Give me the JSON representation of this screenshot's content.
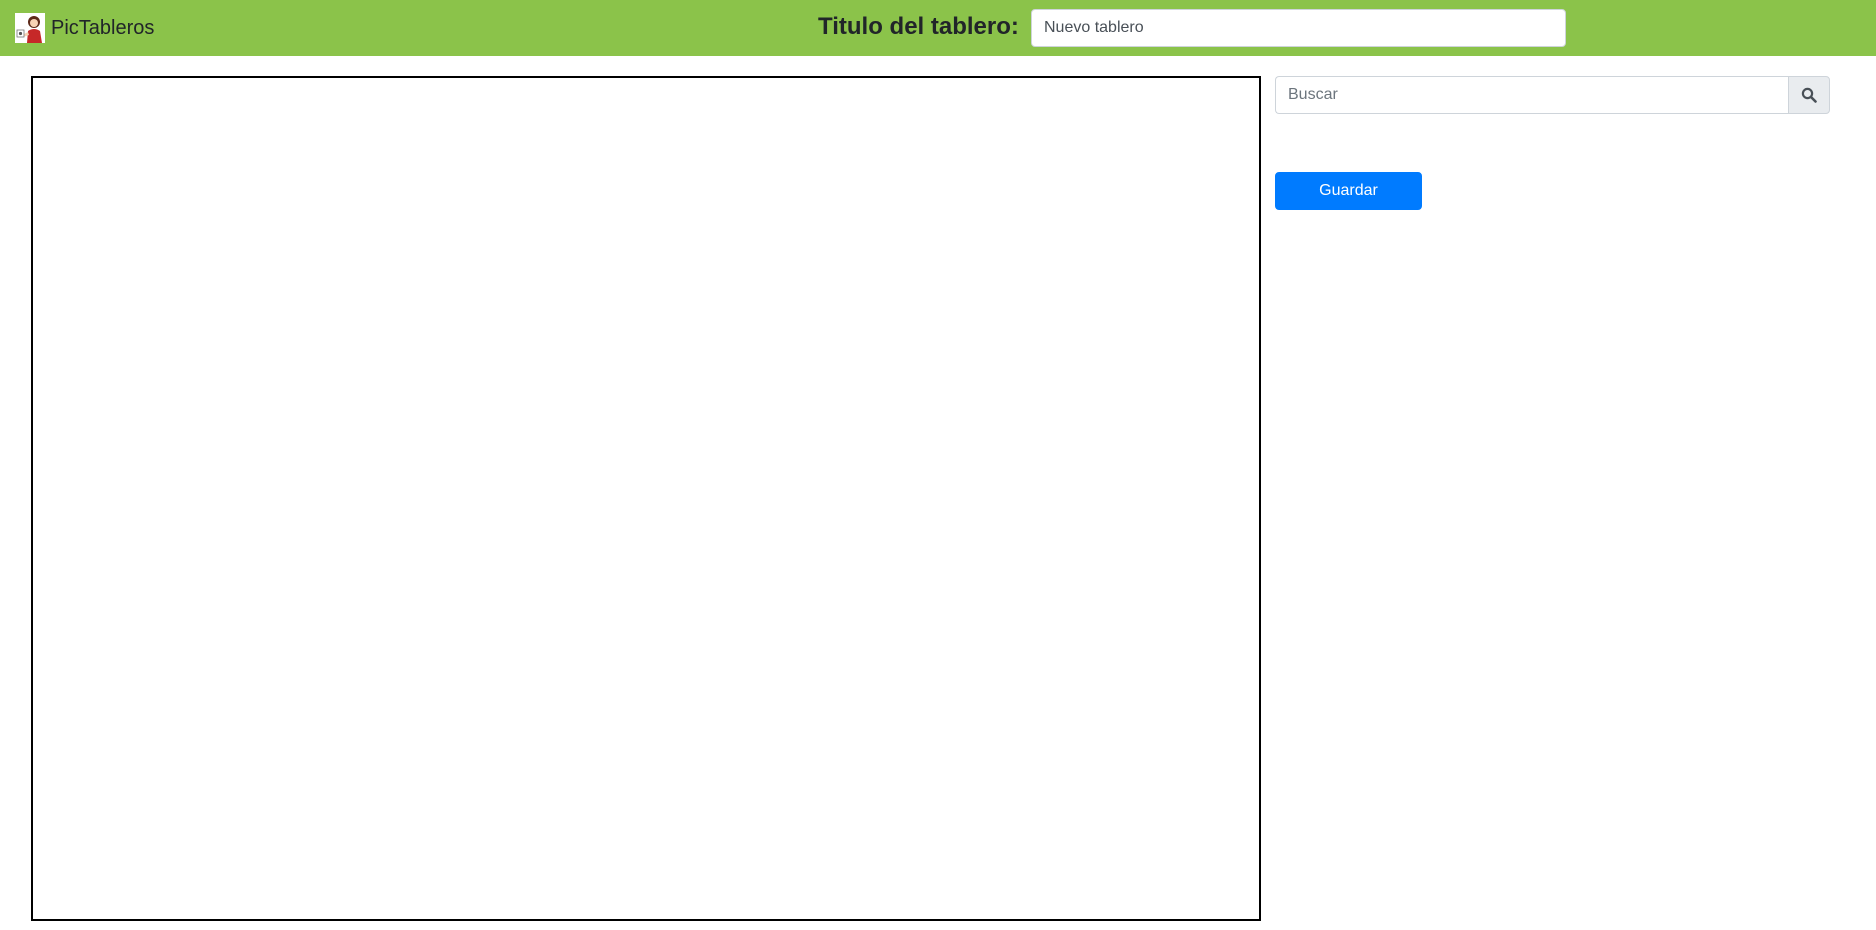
{
  "header": {
    "brand": {
      "logo_icon": "girl-with-pictogram-icon",
      "name": "PicTableros"
    },
    "board_title_label": "Titulo del tablero:",
    "board_title_value": "Nuevo tablero",
    "background_color": "#8bc34a"
  },
  "sidebar": {
    "search": {
      "placeholder": "Buscar",
      "value": "",
      "icon": "search-icon"
    },
    "save_button_label": "Guardar",
    "save_button_color": "#007bff"
  }
}
